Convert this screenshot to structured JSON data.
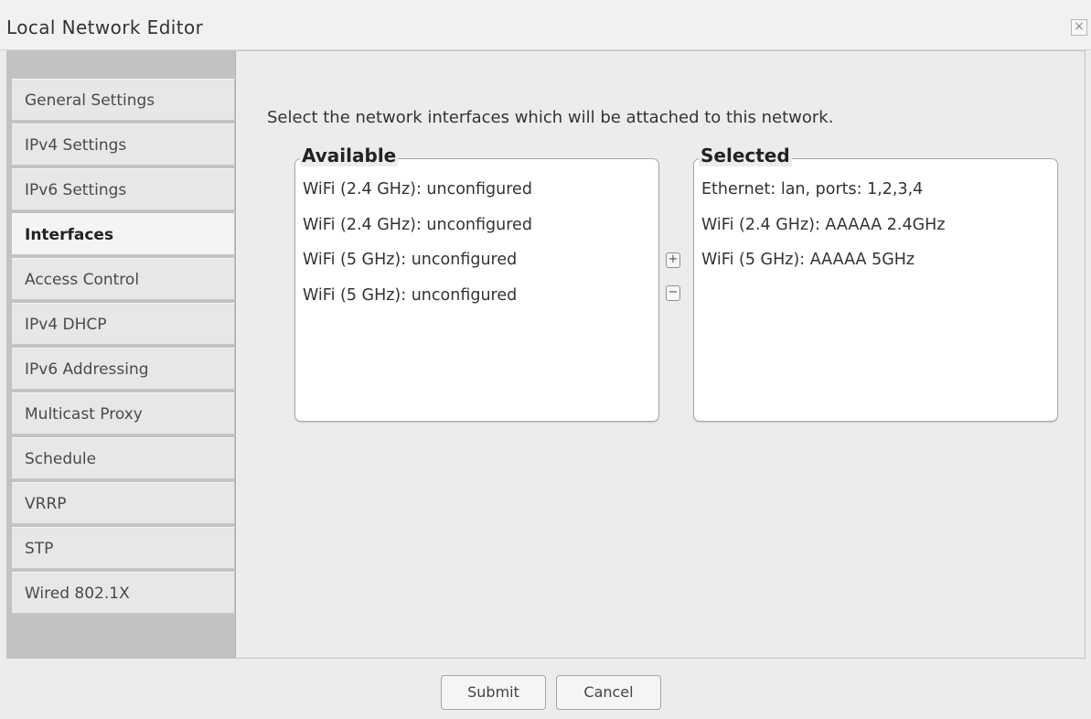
{
  "window": {
    "title": "Local Network Editor",
    "close_glyph": "×"
  },
  "sidebar": {
    "items": [
      {
        "label": "General Settings"
      },
      {
        "label": "IPv4 Settings"
      },
      {
        "label": "IPv6 Settings"
      },
      {
        "label": "Interfaces",
        "active": true
      },
      {
        "label": "Access Control"
      },
      {
        "label": "IPv4 DHCP"
      },
      {
        "label": "IPv6 Addressing"
      },
      {
        "label": "Multicast Proxy"
      },
      {
        "label": "Schedule"
      },
      {
        "label": "VRRP"
      },
      {
        "label": "STP"
      },
      {
        "label": "Wired 802.1X"
      }
    ]
  },
  "main": {
    "instruction": "Select the network interfaces which will be attached to this network.",
    "available": {
      "legend": "Available",
      "items": [
        "WiFi (2.4 GHz): unconfigured",
        "WiFi (2.4 GHz): unconfigured",
        "WiFi (5 GHz): unconfigured",
        "WiFi (5 GHz): unconfigured"
      ]
    },
    "selected": {
      "legend": "Selected",
      "items": [
        "Ethernet: lan, ports: 1,2,3,4",
        "WiFi (2.4 GHz): AAAAA 2.4GHz",
        "WiFi (5 GHz): AAAAA 5GHz"
      ]
    },
    "add_glyph": "+",
    "remove_glyph": "−"
  },
  "footer": {
    "submit_label": "Submit",
    "cancel_label": "Cancel"
  }
}
